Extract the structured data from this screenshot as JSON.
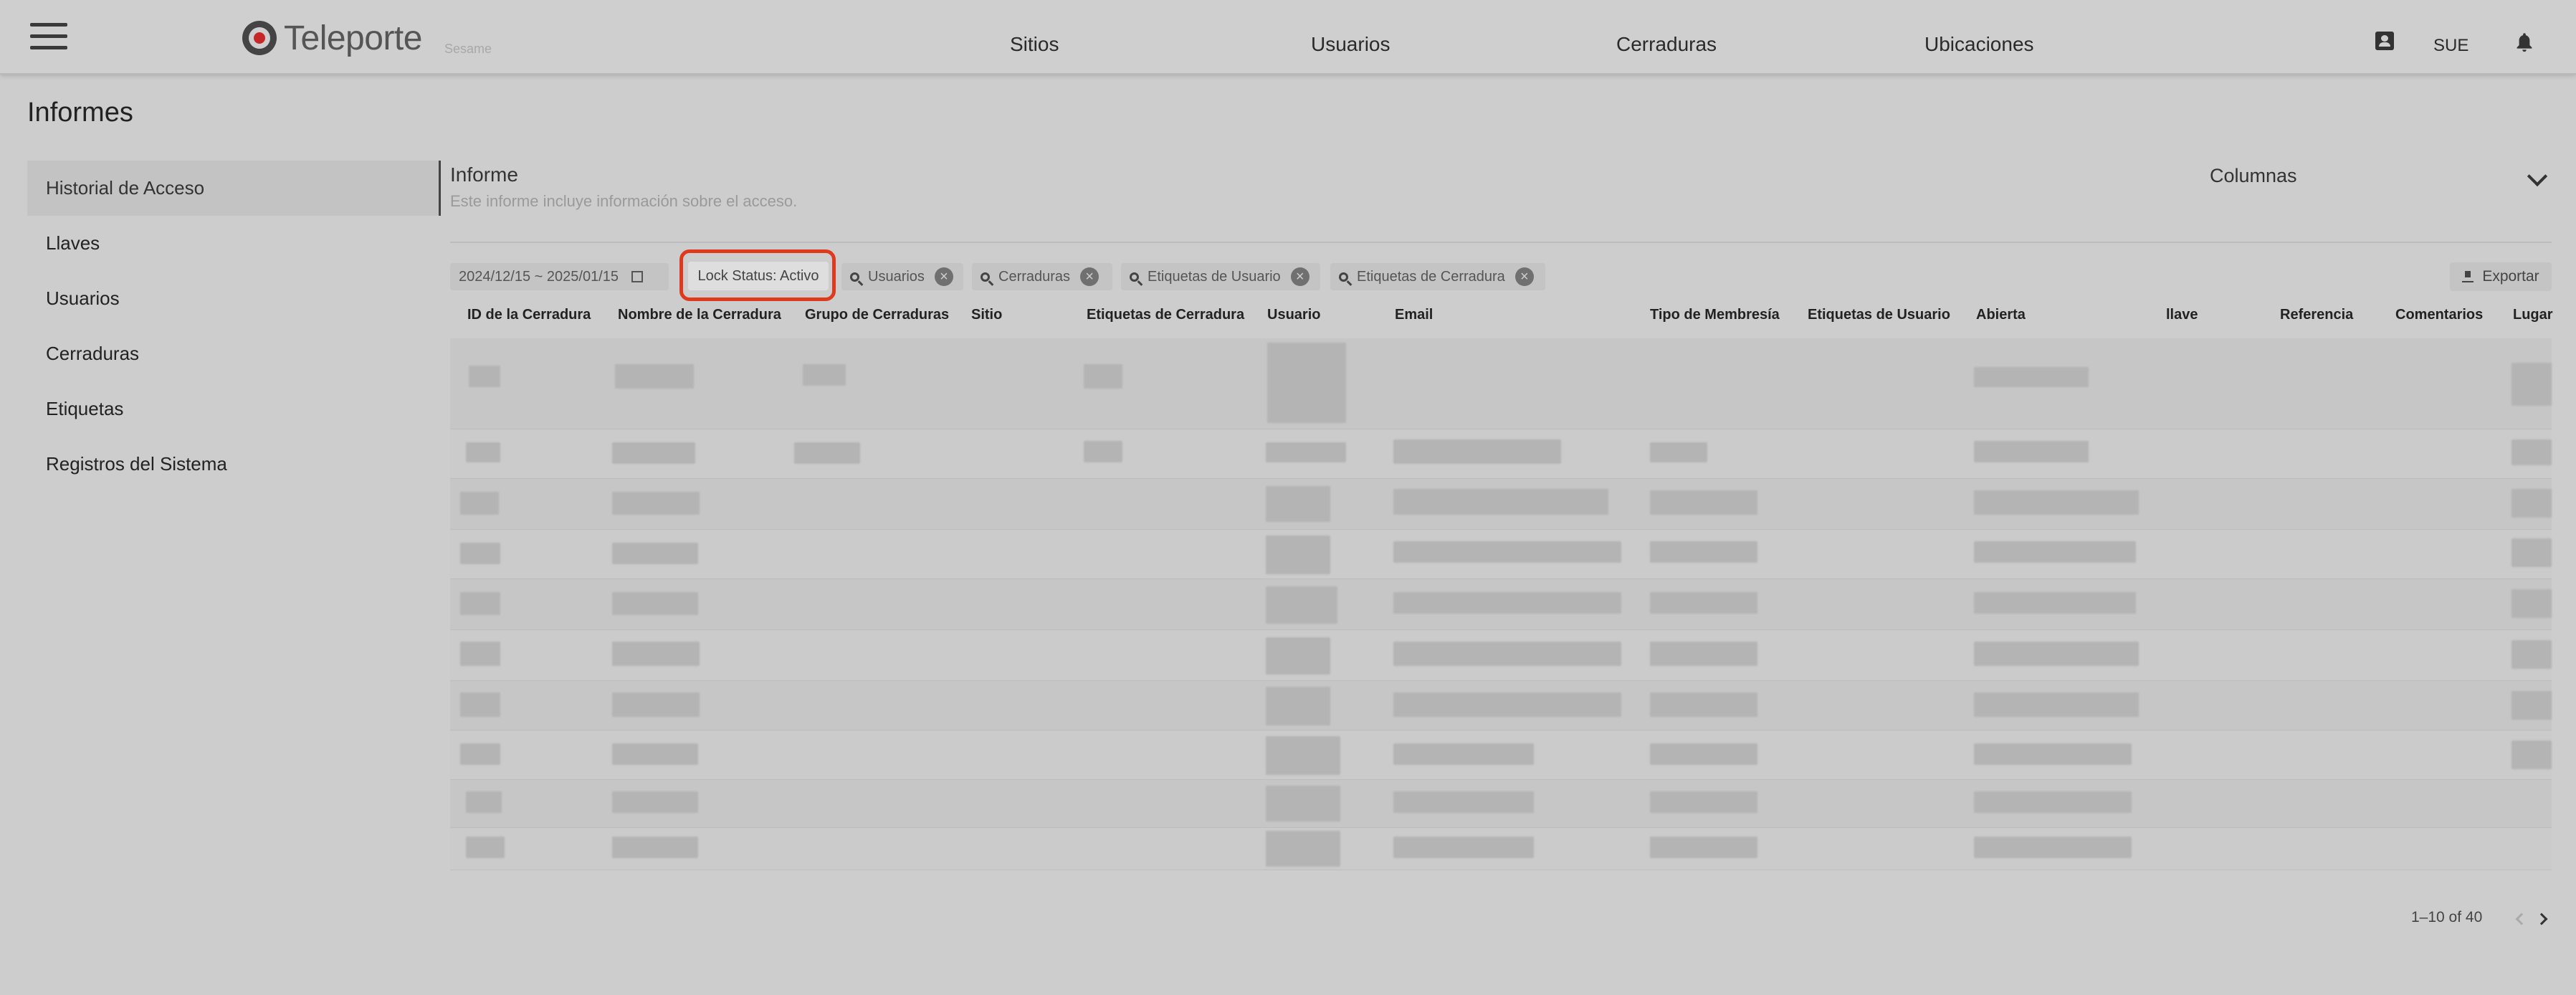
{
  "header": {
    "brand": "Teleporte",
    "brand_sub": "Sesame",
    "nav": [
      "Sitios",
      "Usuarios",
      "Cerraduras",
      "Ubicaciones"
    ],
    "user_initials": "SUE",
    "icons": [
      "menu-icon",
      "contact-icon",
      "bell-icon"
    ]
  },
  "page": {
    "title": "Informes"
  },
  "sidebar": {
    "items": [
      {
        "label": "Historial de Acceso",
        "active": true
      },
      {
        "label": "Llaves"
      },
      {
        "label": "Usuarios"
      },
      {
        "label": "Cerraduras"
      },
      {
        "label": "Etiquetas"
      },
      {
        "label": "Registros del Sistema"
      }
    ]
  },
  "report": {
    "title": "Informe",
    "description": "Este informe incluye información sobre el acceso.",
    "columns_label": "Columnas"
  },
  "filters": {
    "date_range": "2024/12/15 ~ 2025/01/15",
    "lock_status": "Lock Status: Activo",
    "chips": [
      "Usuarios",
      "Cerraduras",
      "Etiquetas de Usuario",
      "Etiquetas de Cerradura"
    ],
    "export_label": "Exportar"
  },
  "table": {
    "columns": [
      "ID de la Cerradura",
      "Nombre de la Cerradura",
      "Grupo de Cerraduras",
      "Sitio",
      "Etiquetas de Cerradura",
      "Usuario",
      "Email",
      "Tipo de Membresía",
      "Etiquetas de Usuario",
      "Abierta",
      "llave",
      "Referencia",
      "Comentarios",
      "Lugar"
    ]
  },
  "pagination": {
    "range": "1–10 of 40"
  }
}
